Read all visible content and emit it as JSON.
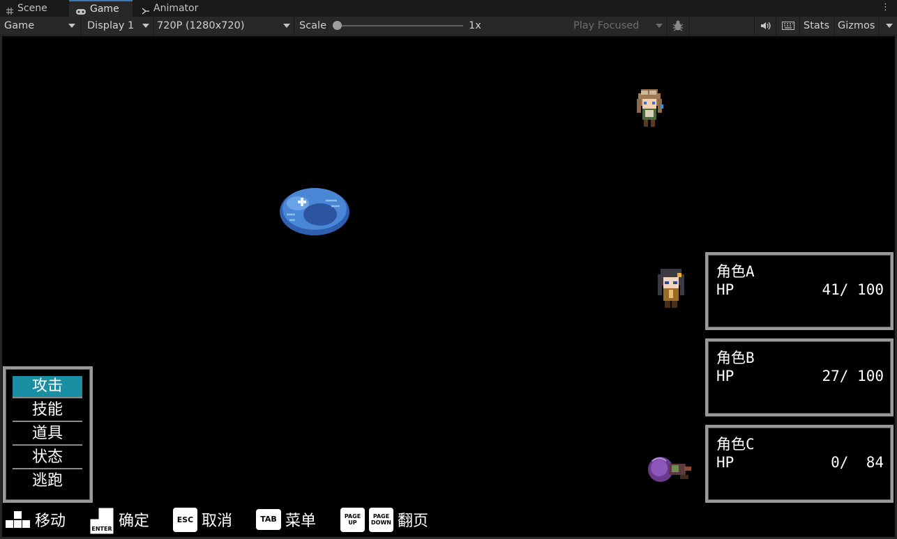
{
  "editor": {
    "tabs": [
      {
        "label": "Scene",
        "icon": "grid-icon"
      },
      {
        "label": "Game",
        "icon": "gamepad-icon"
      },
      {
        "label": "Animator",
        "icon": "animator-icon"
      }
    ],
    "more_icon": "⋮"
  },
  "toolbar": {
    "view_mode": "Game",
    "display": "Display 1",
    "resolution": "720P (1280x720)",
    "scale_label": "Scale",
    "scale_value": "1x",
    "scale_fraction": 0.0,
    "play_mode": "Play Focused",
    "stats_label": "Stats",
    "gizmos_label": "Gizmos"
  },
  "game": {
    "commands": [
      {
        "label": "攻击",
        "selected": true
      },
      {
        "label": "技能",
        "selected": false
      },
      {
        "label": "道具",
        "selected": false
      },
      {
        "label": "状态",
        "selected": false
      },
      {
        "label": "逃跑",
        "selected": false
      }
    ],
    "party": [
      {
        "name": "角色A",
        "hp_label": "HP",
        "hp_text": "41/ 100",
        "hp": 41,
        "max_hp": 100
      },
      {
        "name": "角色B",
        "hp_label": "HP",
        "hp_text": "27/ 100",
        "hp": 27,
        "max_hp": 100
      },
      {
        "name": "角色C",
        "hp_label": "HP",
        "hp_text": " 0/  84",
        "hp": 0,
        "max_hp": 84
      }
    ],
    "hints": [
      {
        "key": "",
        "label": "移动",
        "icon": "dpad-icon"
      },
      {
        "key": "ENTER",
        "label": "确定",
        "icon": "enter-key-icon"
      },
      {
        "key": "ESC",
        "label": "取消",
        "icon": "esc-key-icon"
      },
      {
        "key": "TAB",
        "label": "菜单",
        "icon": "tab-key-icon"
      },
      {
        "key": "PAGE UP",
        "label": "",
        "icon": "pageup-key-icon"
      },
      {
        "key": "PAGE DOWN",
        "label": "翻页",
        "icon": "pagedown-key-icon"
      }
    ],
    "colors": {
      "menu_highlight": "#1a8ea3",
      "window_border": "#9a9a9a",
      "slime": "#3f74c8"
    }
  }
}
